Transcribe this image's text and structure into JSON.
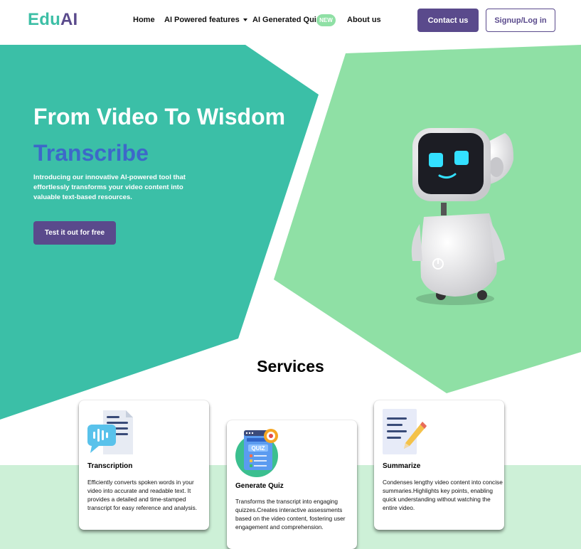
{
  "header": {
    "logo_part1": "Edu",
    "logo_part2": "AI",
    "nav": {
      "home": "Home",
      "features": "AI Powered features",
      "quiz": "AI Generated Quiz",
      "quiz_badge": "NEW",
      "about": "About us"
    },
    "contact_label": "Contact us",
    "signup_label": "Signup/Log in"
  },
  "hero": {
    "title": "From Video To Wisdom",
    "subtitle": "Transcribe",
    "description": "Introducing our innovative AI-powered tool that effortlessly transforms your video content into valuable text-based resources.",
    "cta_label": "Test it out for free"
  },
  "services": {
    "title": "Services",
    "cards": [
      {
        "title": "Transcription",
        "description": "Efficiently converts spoken words in your video into accurate and readable text. It provides a detailed and time-stamped transcript for easy reference and analysis.",
        "icon": "transcription-icon"
      },
      {
        "title": "Generate Quiz",
        "description": "Transforms the transcript into engaging quizzes.Creates interactive assessments based on the video content, fostering user engagement and comprehension.",
        "icon": "quiz-icon",
        "icon_text": "QUIZ"
      },
      {
        "title": "Summarize",
        "description": "Condenses lengthy video content into concise summaries.Highlights key points, enabling quick understanding without watching the entire video.",
        "icon": "summarize-icon"
      }
    ]
  },
  "colors": {
    "teal": "#3dbfa6",
    "light_green": "#8fe0a5",
    "pale_green": "#cdf0d7",
    "purple": "#5a4a8c",
    "blue": "#3d68c9"
  }
}
